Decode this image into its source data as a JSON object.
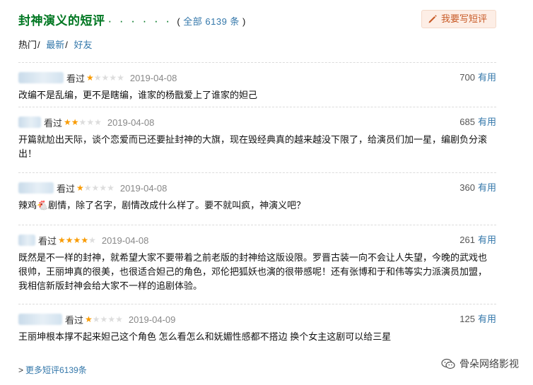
{
  "header": {
    "title": "封神演义的短评",
    "dots": "· · · · · ·",
    "total_open": "( ",
    "total": "全部 6139 条",
    "total_close": " )",
    "write_button": "我要写短评"
  },
  "sorts": {
    "hot": "热门",
    "separator": "/",
    "latest": "最新",
    "friends": "好友"
  },
  "reviews": [
    {
      "status": "看过",
      "rating": 1,
      "date": "2019-04-08",
      "votes": "700",
      "useful_label": "有用",
      "content": "改编不是乱编，更不是瞎编，谁家的杨戬爱上了谁家的妲己"
    },
    {
      "status": "看过",
      "rating": 2,
      "date": "2019-04-08",
      "votes": "685",
      "useful_label": "有用",
      "content": "开篇就尬出天际，谈个恋爱而已还要扯封神的大旗，现在毁经典真的越来越没下限了，给演员们加一星，编剧负分滚出！"
    },
    {
      "status": "看过",
      "rating": 1,
      "date": "2019-04-08",
      "votes": "360",
      "useful_label": "有用",
      "content": "辣鸡🐔剧情，除了名字，剧情改成什么样了。要不就叫疯，神演义吧？"
    },
    {
      "status": "看过",
      "rating": 4,
      "date": "2019-04-08",
      "votes": "261",
      "useful_label": "有用",
      "content": "既然是不一样的封神，就希望大家不要带着之前老版的封神给这版设限。罗晋古装一向不会让人失望，今晚的武戏也很帅，王丽坤真的很美，也很适合妲己的角色，邓伦把狐妖也演的很带感呢！还有张博和于和伟等实力派演员加盟，我相信新版封神会给大家不一样的追剧体验。"
    },
    {
      "status": "看过",
      "rating": 1,
      "date": "2019-04-09",
      "votes": "125",
      "useful_label": "有用",
      "content": "王丽坤根本撑不起来妲己这个角色 怎么看怎么和妩媚性感都不搭边 换个女主这剧可以给三星"
    }
  ],
  "more_link": "更多短评6139条",
  "more_arrow": ">",
  "watermark": "骨朵网络影视",
  "colors": {
    "title_green": "#007722",
    "link_blue": "#3377aa",
    "star_orange": "#f99b01",
    "button_bg": "#fdeee6",
    "button_text": "#c85a26"
  },
  "icons": {
    "write": "pen-icon",
    "star": "star-icon",
    "watermark": "wechat-logo-icon"
  }
}
